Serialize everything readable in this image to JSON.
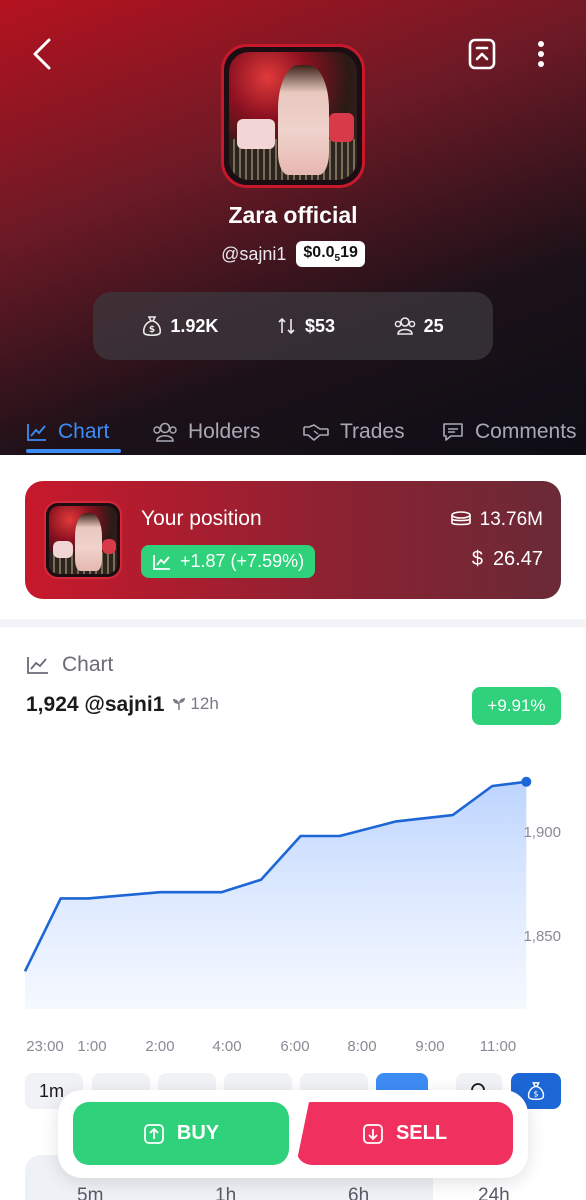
{
  "profile": {
    "name": "Zara official",
    "handle": "@sajni1",
    "price_prefix": "$0.0",
    "price_sub": "5",
    "price_suffix": "19"
  },
  "stats": {
    "market_cap": "1.92K",
    "volume": "$53",
    "holders": "25"
  },
  "tabs": [
    {
      "label": "Chart",
      "icon": "chart-line-icon",
      "active": true
    },
    {
      "label": "Holders",
      "icon": "users-icon"
    },
    {
      "label": "Trades",
      "icon": "handshake-icon"
    },
    {
      "label": "Comments",
      "icon": "comment-icon"
    }
  ],
  "position": {
    "title": "Your position",
    "gain": "+1.87 (+7.59%)",
    "tokens": "13.76M",
    "usd_symbol": "$",
    "usd": "26.47"
  },
  "chart_section": {
    "header": "Chart",
    "summary": "1,924 @sajni1",
    "age": "12h",
    "change": "+9.91%"
  },
  "chart_data": {
    "type": "area",
    "x": [
      "23:00",
      "1:00",
      "2:00",
      "4:00",
      "6:00",
      "8:00",
      "9:00",
      "11:00"
    ],
    "points": [
      {
        "x": "22:40",
        "y": 1833
      },
      {
        "x": "23:40",
        "y": 1868
      },
      {
        "x": "0:50",
        "y": 1868
      },
      {
        "x": "2:00",
        "y": 1871
      },
      {
        "x": "3:50",
        "y": 1871
      },
      {
        "x": "5:00",
        "y": 1877
      },
      {
        "x": "6:10",
        "y": 1898
      },
      {
        "x": "7:20",
        "y": 1898
      },
      {
        "x": "8:30",
        "y": 1905
      },
      {
        "x": "9:40",
        "y": 1908
      },
      {
        "x": "10:50",
        "y": 1922
      },
      {
        "x": "11:50",
        "y": 1924
      }
    ],
    "y_ticks": [
      1850,
      1900
    ],
    "ylim": [
      1812,
      1934
    ],
    "line_color": "#1d66d6",
    "fill_color": "#c7dcff",
    "grid": false
  },
  "ranges": [
    "1m",
    "",
    "",
    "",
    "",
    ""
  ],
  "intervals": [
    "5m",
    "1h",
    "6h",
    "24h"
  ],
  "actions": {
    "buy": "BUY",
    "sell": "SELL"
  },
  "colors": {
    "accent": "#3d8cf5",
    "positive": "#2fd17b",
    "negative": "#f0305e",
    "brand_red": "#c8192c"
  }
}
